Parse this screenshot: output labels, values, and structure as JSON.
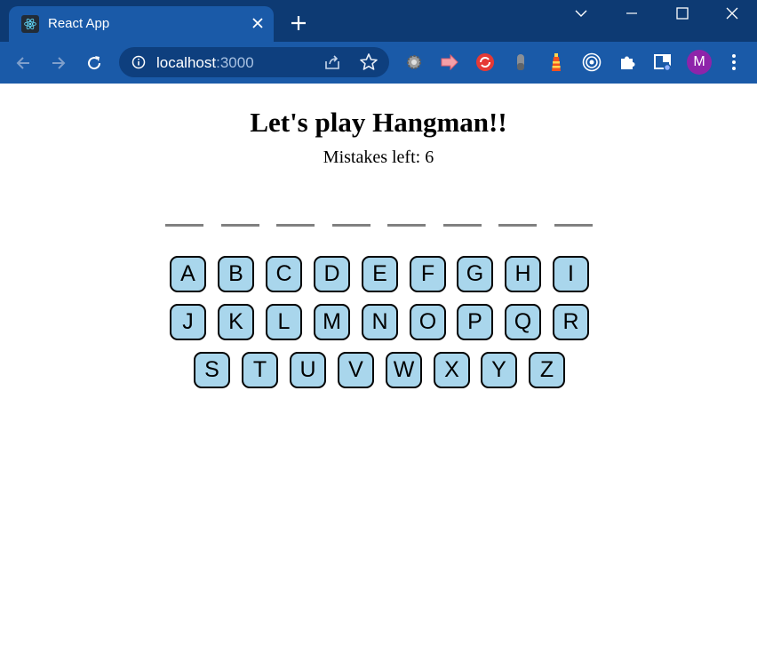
{
  "browser": {
    "tab_title": "React App",
    "url_host": "localhost",
    "url_port": ":3000",
    "profile_initial": "M",
    "colors": {
      "frame": "#0d3a73",
      "toolbar": "#1a5aa8",
      "omnibox": "#0e3f7e",
      "avatar": "#8e24aa"
    },
    "extensions": [
      "settings-gear-icon",
      "pink-arrow-icon",
      "red-sync-icon",
      "gray-pin-icon",
      "lighthouse-icon",
      "target-icon",
      "puzzle-icon",
      "sidebar-icon"
    ]
  },
  "game": {
    "title": "Let's play Hangman!!",
    "mistakes_label": "Mistakes left: 6",
    "word_length": 8,
    "key_color": "#a9d6ec",
    "keyboard_rows": [
      [
        "A",
        "B",
        "C",
        "D",
        "E",
        "F",
        "G",
        "H",
        "I"
      ],
      [
        "J",
        "K",
        "L",
        "M",
        "N",
        "O",
        "P",
        "Q",
        "R"
      ],
      [
        "S",
        "T",
        "U",
        "V",
        "W",
        "X",
        "Y",
        "Z"
      ]
    ]
  }
}
